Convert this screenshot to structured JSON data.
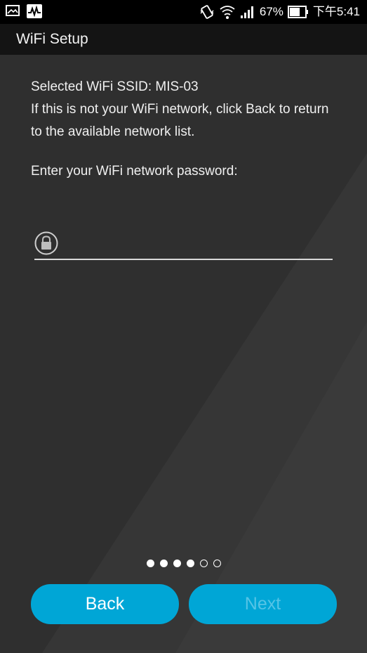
{
  "status_bar": {
    "battery_percent": "67%",
    "time": "下午5:41",
    "icons": [
      "gallery-icon",
      "activity-app-icon",
      "vibrate-icon",
      "wifi-icon",
      "signal-icon",
      "battery-icon"
    ]
  },
  "title_bar": {
    "title": "WiFi Setup"
  },
  "content": {
    "selected_ssid": "Selected WiFi SSID: MIS-03",
    "info": "If this is not your WiFi network, click Back to return to the available network list.",
    "password_prompt": "Enter your WiFi network password:",
    "password_value": "",
    "password_placeholder": ""
  },
  "pager": {
    "total_steps": 6,
    "filled_steps": 4
  },
  "buttons": {
    "back_label": "Back",
    "next_label": "Next"
  },
  "colors": {
    "accent": "#00a6d6",
    "background": "#2e2e2e",
    "title_bar": "#141414",
    "next_disabled_text": "#56c4e6"
  }
}
